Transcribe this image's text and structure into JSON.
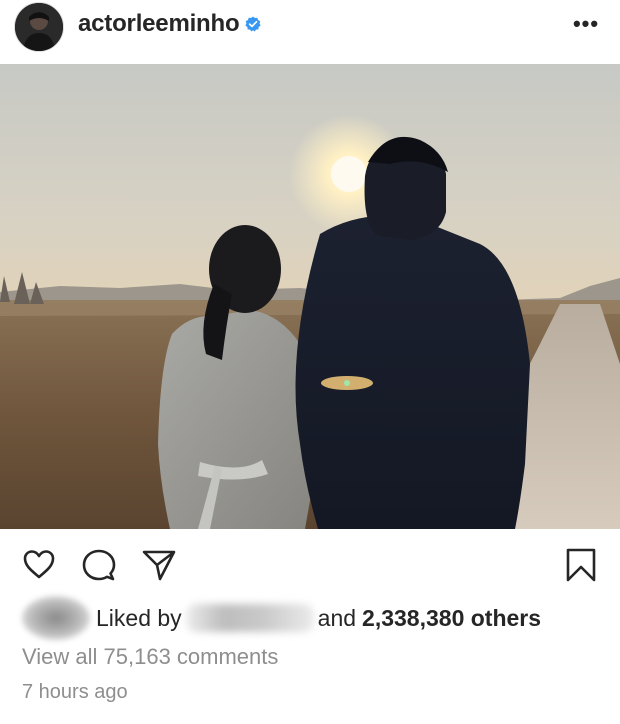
{
  "header": {
    "username": "actorleeminho",
    "verified_icon": "verified-badge-icon",
    "more_icon": "more-options-icon",
    "more_label": "•••"
  },
  "post": {
    "image_description_icon": "post-photo"
  },
  "actions": {
    "like_icon": "heart-icon",
    "comment_icon": "comment-bubble-icon",
    "share_icon": "paper-plane-icon",
    "save_icon": "bookmark-icon"
  },
  "likes": {
    "prefix": "Liked by",
    "middle": "and",
    "count": "2,338,380 others"
  },
  "comments": {
    "view_all": "View all 75,163 comments"
  },
  "meta": {
    "timestamp": "7 hours ago"
  },
  "colors": {
    "text": "#262626",
    "secondary": "#8e8e8e",
    "verified": "#3897f0"
  }
}
